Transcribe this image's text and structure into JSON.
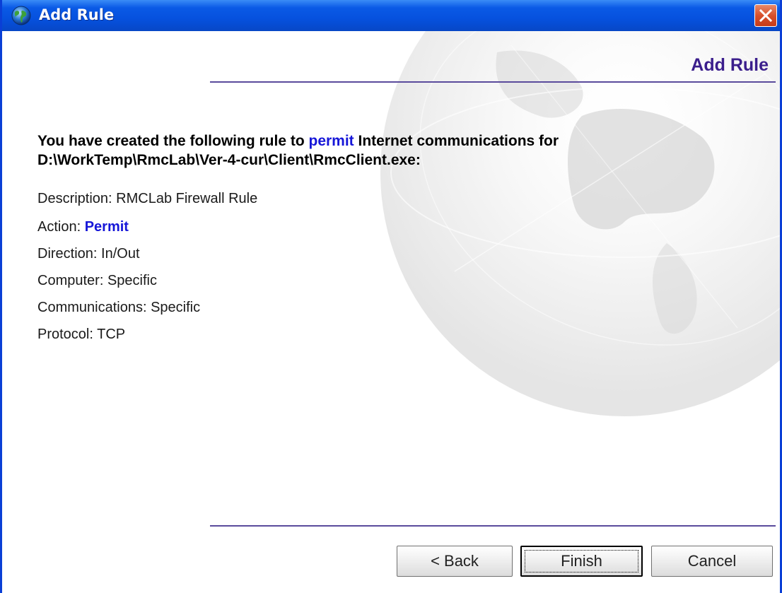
{
  "window": {
    "title": "Add Rule",
    "close_icon": "close-icon",
    "app_icon": "globe-icon"
  },
  "header": {
    "title": "Add Rule"
  },
  "summary": {
    "line1_prefix": "You have created the following rule to ",
    "line1_action": "permit",
    "line1_suffix": " Internet communications for",
    "path": "D:\\WorkTemp\\RmcLab\\Ver-4-cur\\Client\\RmcClient.exe:"
  },
  "details": {
    "description_label": "Description: ",
    "description_value": "RMCLab Firewall Rule",
    "action_label": "Action: ",
    "action_value": "Permit",
    "direction_label": "Direction: ",
    "direction_value": "In/Out",
    "computer_label": "Computer: ",
    "computer_value": "Specific",
    "communications_label": "Communications: ",
    "communications_value": "Specific",
    "protocol_label": "Protocol: ",
    "protocol_value": "TCP"
  },
  "buttons": {
    "back": "< Back",
    "finish": "Finish",
    "cancel": "Cancel"
  },
  "colors": {
    "titlebar": "#0a5ae6",
    "header_text": "#3b1e8c",
    "highlight": "#1616d8",
    "close_button": "#d8502c"
  }
}
